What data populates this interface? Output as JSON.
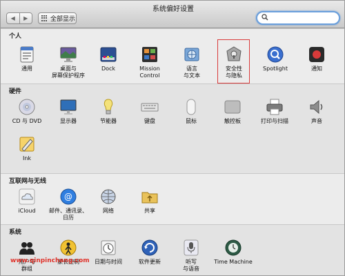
{
  "window": {
    "title": "系统偏好设置"
  },
  "toolbar": {
    "back": "◀",
    "forward": "▶",
    "show_all": "全部显示",
    "search_value": ""
  },
  "sections": {
    "personal": {
      "title": "个人",
      "items": [
        {
          "label": "通用",
          "icon": "general-icon"
        },
        {
          "label": "桌面与\n屏幕保护程序",
          "icon": "desktop-icon"
        },
        {
          "label": "Dock",
          "icon": "dock-icon"
        },
        {
          "label": "Mission\nControl",
          "icon": "mission-control-icon"
        },
        {
          "label": "语言\n与文本",
          "icon": "language-icon"
        },
        {
          "label": "安全性\n与隐私",
          "icon": "security-icon"
        },
        {
          "label": "Spotlight",
          "icon": "spotlight-icon"
        },
        {
          "label": "通知",
          "icon": "notifications-icon"
        }
      ]
    },
    "hardware": {
      "title": "硬件",
      "items": [
        {
          "label": "CD 与 DVD",
          "icon": "cd-dvd-icon"
        },
        {
          "label": "显示器",
          "icon": "display-icon"
        },
        {
          "label": "节能器",
          "icon": "energy-saver-icon"
        },
        {
          "label": "键盘",
          "icon": "keyboard-icon"
        },
        {
          "label": "鼠标",
          "icon": "mouse-icon"
        },
        {
          "label": "触控板",
          "icon": "trackpad-icon"
        },
        {
          "label": "打印与扫描",
          "icon": "printer-icon"
        },
        {
          "label": "声音",
          "icon": "sound-icon"
        },
        {
          "label": "Ink",
          "icon": "ink-icon"
        }
      ]
    },
    "internet": {
      "title": "互联网与无线",
      "items": [
        {
          "label": "iCloud",
          "icon": "icloud-icon"
        },
        {
          "label": "邮件、通讯录、\n日历",
          "icon": "mail-icon"
        },
        {
          "label": "网络",
          "icon": "network-icon"
        },
        {
          "label": "共享",
          "icon": "sharing-icon"
        }
      ]
    },
    "system": {
      "title": "系统",
      "items": [
        {
          "label": "用户与\n群组",
          "icon": "users-icon"
        },
        {
          "label": "家长控制",
          "icon": "parental-controls-icon"
        },
        {
          "label": "日期与时间",
          "icon": "date-time-icon"
        },
        {
          "label": "软件更新",
          "icon": "software-update-icon"
        },
        {
          "label": "听写\n与语音",
          "icon": "dictation-icon"
        },
        {
          "label": "Time Machine",
          "icon": "time-machine-icon"
        }
      ]
    }
  },
  "watermark": "www.qinpinchang.com"
}
